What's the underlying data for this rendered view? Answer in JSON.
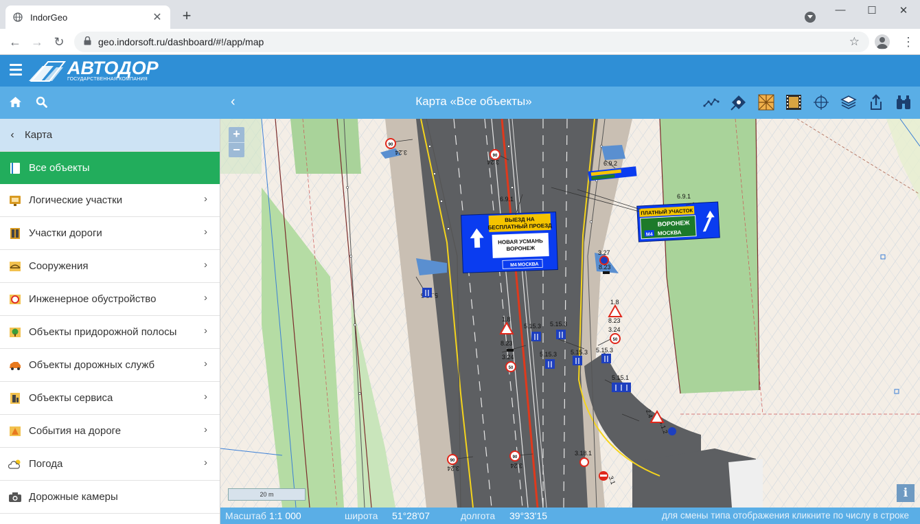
{
  "browser": {
    "tab_title": "IndorGeo",
    "url": "geo.indorsoft.ru/dashboard/#!/app/map",
    "new_tab_icon": "plus-icon",
    "window_controls": [
      "minimize-icon",
      "maximize-icon",
      "close-icon"
    ]
  },
  "app": {
    "logo_text": "АВТОДОР",
    "logo_subtitle": "ГОСУДАРСТВЕННАЯ КОМПАНИЯ",
    "map_title": "Карта «Все объекты»",
    "colors": {
      "header": "#2f8fd6",
      "subheader": "#5aaee6",
      "active": "#22ad5c"
    },
    "toolbar_icons": [
      "route-icon",
      "map-pin-icon",
      "grid-layer-icon",
      "film-icon",
      "crosshair-icon",
      "layers-icon",
      "share-icon",
      "binoculars-icon"
    ]
  },
  "sidebar": {
    "header": "Карта",
    "active_item": "Все объекты",
    "items": [
      {
        "label": "Логические участки",
        "icon": "logical-sections-icon"
      },
      {
        "label": "Участки дороги",
        "icon": "road-sections-icon"
      },
      {
        "label": "Сооружения",
        "icon": "bridge-icon"
      },
      {
        "label": "Инженерное обустройство",
        "icon": "road-sign-icon"
      },
      {
        "label": "Объекты придорожной полосы",
        "icon": "tree-icon"
      },
      {
        "label": "Объекты дорожных служб",
        "icon": "service-car-icon"
      },
      {
        "label": "Объекты сервиса",
        "icon": "service-icon"
      },
      {
        "label": "События на дороге",
        "icon": "warning-cone-icon"
      },
      {
        "label": "Погода",
        "icon": "weather-icon"
      },
      {
        "label": "Дорожные камеры",
        "icon": "camera-icon"
      }
    ]
  },
  "map": {
    "zoom_in": "+",
    "zoom_out": "−",
    "scale_bar": "20 m",
    "info": "i",
    "labels": {
      "sign_6_9_1_a": "6.9.1",
      "sign_6_9_1_b": "6.9.1",
      "sign_6_9_2": "6.9.2",
      "sign_5_15_5": "5.15.5",
      "sign_3_27": "3.27",
      "sign_8_23": "8.23",
      "sign_1_8": "1.8",
      "sign_3_24": "3.24",
      "sign_5_15_3": "5.15.3",
      "sign_5_15_1": "5.15.1",
      "sign_3_18_1": "3.18.1",
      "sign_2_4": "2.4",
      "sign_4_1_2": "4.1.2",
      "sign_3_1": "3.1",
      "speed_limit": "90",
      "speed_limit_50": "50"
    },
    "big_sign_left": {
      "line1": "ВЫЕЗД НА",
      "line2": "БЕСПЛАТНЫЙ ПРОЕЗД",
      "line3": "НОВАЯ УСМАНЬ",
      "line4": "ВОРОНЕЖ",
      "road": "М4",
      "city": "МОСКВА"
    },
    "big_sign_right": {
      "top": "ПЛАТНЫЙ УЧАСТОК",
      "line1": "ВОРОНЕЖ",
      "road": "М4",
      "city": "МОСКВА"
    }
  },
  "status": {
    "scale_label": "Масштаб",
    "scale_value": "1:1 000",
    "lat_label": "широта",
    "lat_value": "51°28'07",
    "lon_label": "долгота",
    "lon_value": "39°33'15",
    "hint": "для смены типа отображения кликните по числу в строке"
  },
  "chart_data": null
}
